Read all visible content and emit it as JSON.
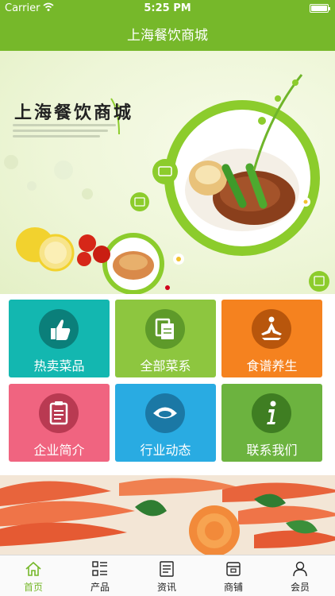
{
  "status_bar": {
    "carrier": "Carrier",
    "time": "5:25 PM"
  },
  "nav": {
    "title": "上海餐饮商城"
  },
  "banner": {
    "headline": "上海餐饮商城"
  },
  "menu_tiles": [
    {
      "label": "热卖菜品",
      "icon": "thumbs-up-icon",
      "color": "#13b7b0"
    },
    {
      "label": "全部菜系",
      "icon": "documents-icon",
      "color": "#8dc63f"
    },
    {
      "label": "食谱养生",
      "icon": "meditation-icon",
      "color": "#f5821f"
    },
    {
      "label": "企业简介",
      "icon": "clipboard-icon",
      "color": "#f06480"
    },
    {
      "label": "行业动态",
      "icon": "eye-icon",
      "color": "#29abe2"
    },
    {
      "label": "联系我们",
      "icon": "info-icon",
      "color": "#6cb33f"
    }
  ],
  "tab_bar": [
    {
      "label": "首页",
      "icon": "home-icon",
      "active": true
    },
    {
      "label": "产品",
      "icon": "grid-list-icon",
      "active": false
    },
    {
      "label": "资讯",
      "icon": "news-icon",
      "active": false
    },
    {
      "label": "商铺",
      "icon": "store-icon",
      "active": false
    },
    {
      "label": "会员",
      "icon": "user-icon",
      "active": false
    }
  ],
  "colors": {
    "brand_green": "#76b82a",
    "active_tab": "#76b82a",
    "carousel_dot": "#d0021b"
  }
}
